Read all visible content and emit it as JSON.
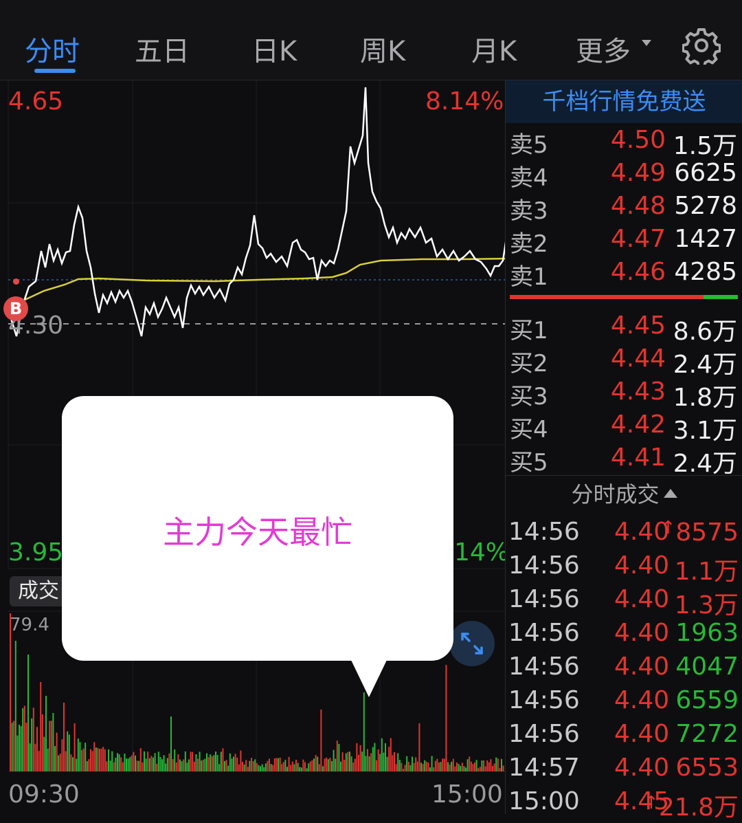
{
  "tabs": [
    {
      "label": "分时",
      "active": true
    },
    {
      "label": "五日"
    },
    {
      "label": "日K"
    },
    {
      "label": "周K"
    },
    {
      "label": "月K"
    },
    {
      "label": "更多"
    }
  ],
  "chart": {
    "high_price": "4.65",
    "high_pct": "8.14%",
    "ref_price": "4.30",
    "low_price": "3.95",
    "low_pct": "14%",
    "volume_tab_label": "成交",
    "volume_max_label": "79.4",
    "time_start": "09:30",
    "time_end": "15:00",
    "marker_label": "B",
    "colors": {
      "up": "#e4342f",
      "down": "#27b938",
      "price_line": "#ffffff",
      "avg_line": "#d8cf3a",
      "accent": "#3c8df3"
    }
  },
  "tooltip": {
    "text": "主力今天最忙"
  },
  "promo_banner": "千档行情免费送",
  "order_book": {
    "asks": [
      {
        "label": "卖5",
        "price": "4.50",
        "volume": "1.5万"
      },
      {
        "label": "卖4",
        "price": "4.49",
        "volume": "6625"
      },
      {
        "label": "卖3",
        "price": "4.48",
        "volume": "5278"
      },
      {
        "label": "卖2",
        "price": "4.47",
        "volume": "1427"
      },
      {
        "label": "卖1",
        "price": "4.46",
        "volume": "4285"
      }
    ],
    "bids": [
      {
        "label": "买1",
        "price": "4.45",
        "volume": "8.6万"
      },
      {
        "label": "买2",
        "price": "4.44",
        "volume": "2.4万"
      },
      {
        "label": "买3",
        "price": "4.43",
        "volume": "1.8万"
      },
      {
        "label": "买4",
        "price": "4.42",
        "volume": "3.1万"
      },
      {
        "label": "买5",
        "price": "4.41",
        "volume": "2.4万"
      }
    ]
  },
  "ticks_header": "分时成交",
  "ticks": [
    {
      "time": "14:56",
      "price": "4.40",
      "volume": "8575",
      "dir": "up",
      "arrow": "↑"
    },
    {
      "time": "14:56",
      "price": "4.40",
      "volume": "1.1万",
      "dir": "up"
    },
    {
      "time": "14:56",
      "price": "4.40",
      "volume": "1.3万",
      "dir": "up"
    },
    {
      "time": "14:56",
      "price": "4.40",
      "volume": "1963",
      "dir": "down"
    },
    {
      "time": "14:56",
      "price": "4.40",
      "volume": "4047",
      "dir": "down"
    },
    {
      "time": "14:56",
      "price": "4.40",
      "volume": "6559",
      "dir": "down"
    },
    {
      "time": "14:56",
      "price": "4.40",
      "volume": "7272",
      "dir": "down"
    },
    {
      "time": "14:57",
      "price": "4.40",
      "volume": "6553",
      "dir": "up"
    },
    {
      "time": "15:00",
      "price": "4.45",
      "volume": "21.8万",
      "dir": "up",
      "arrow": "↑",
      "small": true
    }
  ]
}
